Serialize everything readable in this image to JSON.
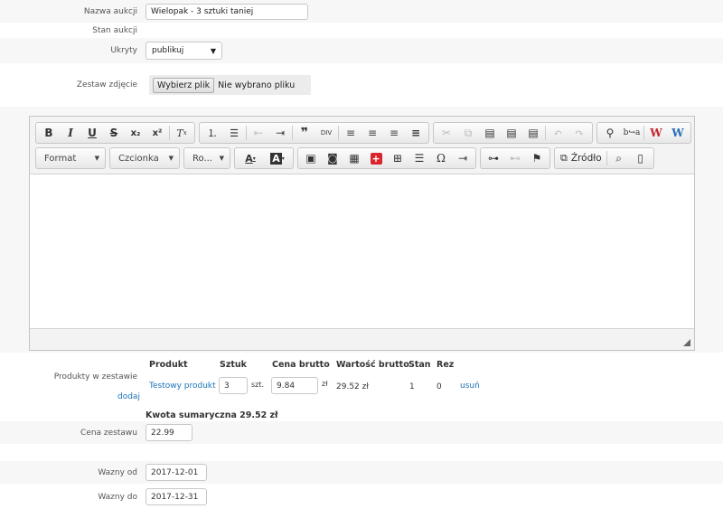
{
  "fields": {
    "auction_name_label": "Nazwa aukcji",
    "auction_name_value": "Wielopak - 3 sztuki taniej",
    "auction_state_label": "Stan aukcji",
    "hidden_label": "Ukryty",
    "hidden_value": "publikuj",
    "photos_label": "Zestaw zdjęcie",
    "file_button": "Wybierz plik",
    "file_status": "Nie wybrano pliku"
  },
  "editor": {
    "format_label": "Format",
    "font_label": "Czcionka",
    "size_label": "Ro...",
    "source_label": "Źródło",
    "icons_row1": [
      [
        "bold-icon",
        "B"
      ],
      [
        "italic-icon",
        "I"
      ],
      [
        "underline-icon",
        "U"
      ],
      [
        "strike-icon",
        "S"
      ],
      [
        "subscript-icon",
        "x₂"
      ],
      [
        "superscript-icon",
        "x²"
      ],
      [
        "remove-format-icon",
        "Tx"
      ],
      [
        "numbered-list-icon",
        "≔"
      ],
      [
        "bullet-list-icon",
        "☰"
      ],
      [
        "outdent-icon",
        "⇤"
      ],
      [
        "indent-icon",
        "⇥"
      ],
      [
        "blockquote-icon",
        "❞"
      ],
      [
        "div-icon",
        "DIV"
      ],
      [
        "align-left-icon",
        "≡"
      ],
      [
        "align-center-icon",
        "≡"
      ],
      [
        "align-right-icon",
        "≡"
      ],
      [
        "justify-icon",
        "≡"
      ],
      [
        "cut-icon",
        "✂"
      ],
      [
        "copy-icon",
        "⧉"
      ],
      [
        "paste-icon",
        "📋"
      ],
      [
        "paste-text-icon",
        "📋"
      ],
      [
        "paste-word-icon",
        "📋"
      ],
      [
        "undo-icon",
        "↶"
      ],
      [
        "redo-icon",
        "↷"
      ],
      [
        "find-icon",
        "🔍"
      ],
      [
        "replace-icon",
        "b→a"
      ],
      [
        "w-red-icon",
        "W"
      ],
      [
        "w-blue-icon",
        "W"
      ]
    ]
  },
  "products": {
    "label": "Produkty w zestawie",
    "add_link": "dodaj",
    "headers": [
      "Produkt",
      "Sztuk",
      "Cena brutto",
      "Wartość brutto",
      "Stan",
      "Rez"
    ],
    "row": {
      "name": "Testowy produkt",
      "qty": "3",
      "qty_unit": "szt.",
      "price": "9.84",
      "price_unit": "zł",
      "value": "29.52 zł",
      "stock": "1",
      "reserved": "0",
      "remove": "usuń"
    },
    "sum": "Kwota sumaryczna 29.52 zł"
  },
  "set_price": {
    "label": "Cena zestawu",
    "value": "22.99"
  },
  "valid_from": {
    "label": "Wazny od",
    "value": "2017-12-01"
  },
  "valid_to": {
    "label": "Wazny do",
    "value": "2017-12-31"
  }
}
